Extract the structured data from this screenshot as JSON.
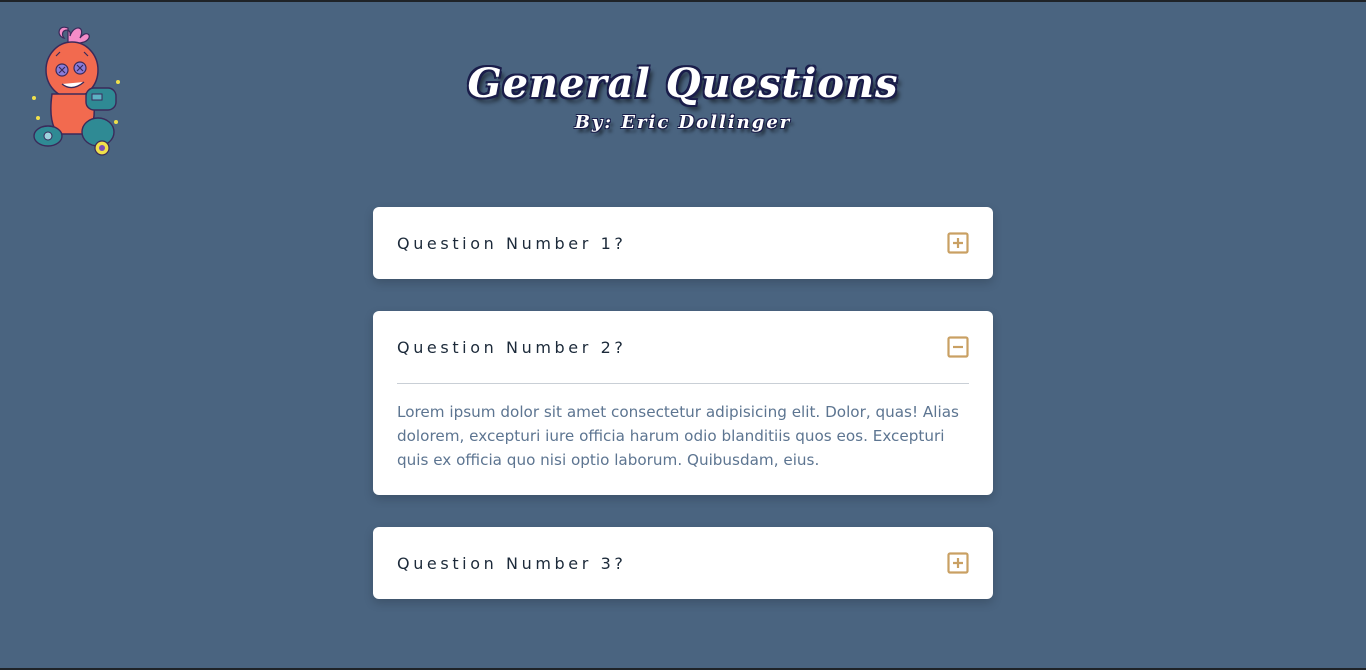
{
  "header": {
    "title": "General Questions",
    "subtitle": "By: Eric Dollinger"
  },
  "logo": {
    "icon": "voodoo-doll-mascot-icon"
  },
  "colors": {
    "background": "#4a6480",
    "card": "#ffffff",
    "accent": "#c9a063",
    "question_text": "#1c2a3a",
    "answer_text": "#5d7591"
  },
  "faq": {
    "items": [
      {
        "question": "Question Number 1?",
        "expanded": false,
        "toggle_icon": "plus-square-icon"
      },
      {
        "question": "Question Number 2?",
        "expanded": true,
        "toggle_icon": "minus-square-icon",
        "answer": "Lorem ipsum dolor sit amet consectetur adipisicing elit. Dolor, quas! Alias dolorem, excepturi iure officia harum odio blanditiis quos eos. Excepturi quis ex officia quo nisi optio laborum. Quibusdam, eius."
      },
      {
        "question": "Question Number 3?",
        "expanded": false,
        "toggle_icon": "plus-square-icon"
      }
    ]
  }
}
